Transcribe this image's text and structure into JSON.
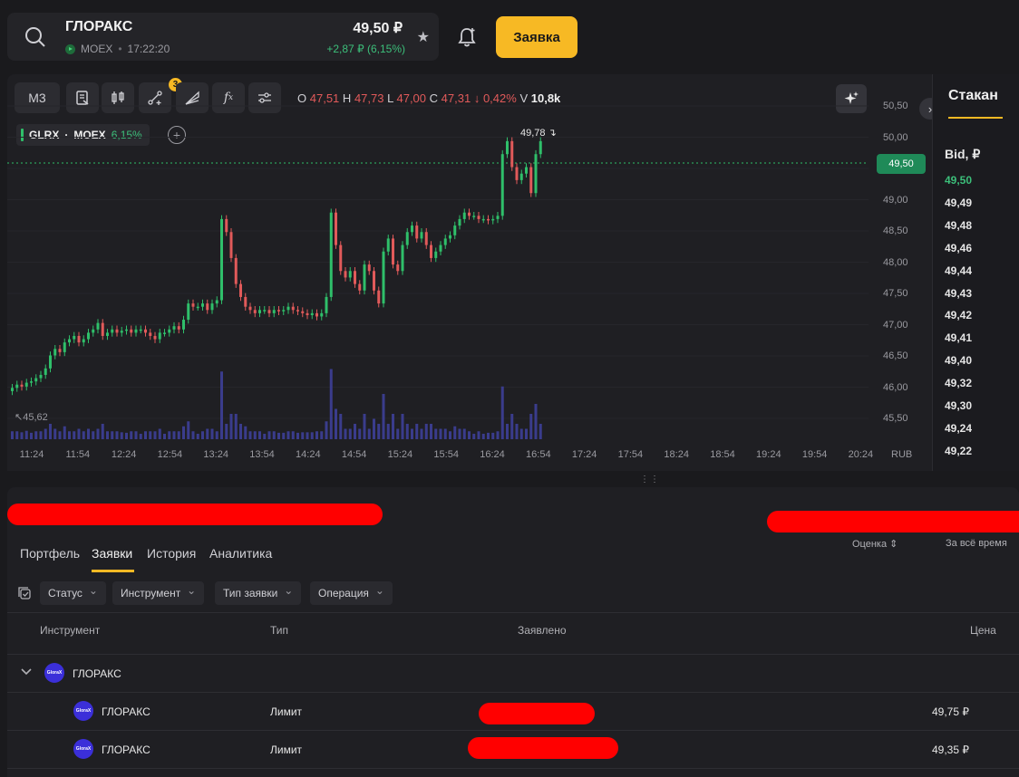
{
  "header": {
    "ticker_name": "ГЛОРАКС",
    "exchange": "MOEX",
    "time": "17:22:20",
    "price": "49,50 ₽",
    "change": "+2,87 ₽ (6,15%)",
    "order_button": "Заявка"
  },
  "chart": {
    "timeframe": "М3",
    "drawing_badge": "3",
    "ohlc": {
      "o_label": "O",
      "o": "47,51",
      "h_label": "H",
      "h": "47,73",
      "l_label": "L",
      "l": "47,00",
      "c_label": "C",
      "c": "47,31",
      "chg": "↓ 0,42%",
      "v_label": "V",
      "v": "10,8k"
    },
    "symbol_tag": {
      "symbol": "GLRX",
      "sep": "·",
      "exchange": "MOEX",
      "pct": "6,15%"
    },
    "high_marker": "49,78",
    "low_marker": "45,62",
    "current_price_tag": "49,50",
    "currency": "RUB",
    "y_ticks": [
      "50,50",
      "50,00",
      "49,50",
      "49,00",
      "48,50",
      "48,00",
      "47,50",
      "47,00",
      "46,50",
      "46,00",
      "45,50"
    ],
    "x_ticks": [
      "11:24",
      "11:54",
      "12:24",
      "12:54",
      "13:24",
      "13:54",
      "14:24",
      "14:54",
      "15:24",
      "15:54",
      "16:24",
      "16:54",
      "17:24",
      "17:54",
      "18:24",
      "18:54",
      "19:24",
      "19:54",
      "20:24"
    ],
    "colors": {
      "up": "#2fbf6a",
      "down": "#e15a5a",
      "volume": "#3a3c8c"
    }
  },
  "chart_data": {
    "type": "candlestick",
    "title": "",
    "xlabel": "",
    "ylabel": "RUB",
    "ylim": [
      45.3,
      50.6
    ],
    "candles_close": [
      45.7,
      45.75,
      45.72,
      45.78,
      45.8,
      45.85,
      45.9,
      46.0,
      46.2,
      46.3,
      46.25,
      46.4,
      46.45,
      46.5,
      46.4,
      46.45,
      46.55,
      46.6,
      46.7,
      46.5,
      46.55,
      46.6,
      46.55,
      46.58,
      46.6,
      46.55,
      46.6,
      46.6,
      46.55,
      46.5,
      46.45,
      46.55,
      46.55,
      46.6,
      46.65,
      46.6,
      46.75,
      47.0,
      46.95,
      46.95,
      47.0,
      46.9,
      47.0,
      47.05,
      48.3,
      48.1,
      47.7,
      47.3,
      47.1,
      46.95,
      46.9,
      46.85,
      46.9,
      46.9,
      46.85,
      46.9,
      46.88,
      46.9,
      46.95,
      46.9,
      46.88,
      46.85,
      46.82,
      46.85,
      46.8,
      46.85,
      47.1,
      48.4,
      47.9,
      47.5,
      47.4,
      47.5,
      47.3,
      47.2,
      47.6,
      47.5,
      47.2,
      47.0,
      47.8,
      48.0,
      47.6,
      47.5,
      47.9,
      48.1,
      48.2,
      48.0,
      48.1,
      47.9,
      47.7,
      47.8,
      47.9,
      48.0,
      48.05,
      48.2,
      48.3,
      48.4,
      48.35,
      48.35,
      48.3,
      48.3,
      48.28,
      48.3,
      48.35,
      49.3,
      49.5,
      49.1,
      48.9,
      49.0,
      49.1,
      48.7,
      49.3,
      49.5
    ]
  },
  "order_book": {
    "tab": "Стакан",
    "bid_header": "Bid, ₽",
    "bids": [
      "49,50",
      "49,49",
      "49,48",
      "49,46",
      "49,44",
      "49,43",
      "49,42",
      "49,41",
      "49,40",
      "49,32",
      "49,30",
      "49,24",
      "49,22"
    ]
  },
  "portfolio": {
    "tabs": [
      "Портфель",
      "Заявки",
      "История",
      "Аналитика"
    ],
    "sort_estimate": "Оценка",
    "sort_period": "За всё время",
    "filters": [
      "Статус",
      "Инструмент",
      "Тип заявки",
      "Операция"
    ],
    "columns": [
      "Инструмент",
      "Тип",
      "Заявлено",
      "Цена"
    ],
    "group": {
      "name": "ГЛОРАКС"
    },
    "rows": [
      {
        "instrument": "ГЛОРАКС",
        "type": "Лимит",
        "price": "49,75 ₽"
      },
      {
        "instrument": "ГЛОРАКС",
        "type": "Лимит",
        "price": "49,35 ₽"
      }
    ],
    "logo_text": "GloraX"
  }
}
